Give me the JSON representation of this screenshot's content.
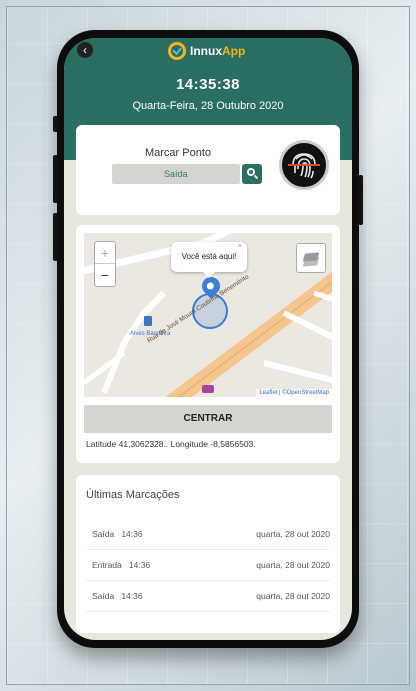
{
  "app": {
    "name_part1": "Innux",
    "name_part2": "App",
    "back_icon": "back-arrow-icon",
    "accent_color": "#2a6d62",
    "logo_ring_color": "#f2b51c"
  },
  "header": {
    "time": "14:35:38",
    "date": "Quarta-Feira, 28 Outubro 2020"
  },
  "punch": {
    "title": "Marcar Ponto",
    "selected_type": "Saída",
    "search_icon": "search-icon",
    "fingerprint_icon": "fingerprint-icon"
  },
  "map": {
    "popup_text": "Você está aqui!",
    "popup_close": "×",
    "zoom_in": "+",
    "zoom_out": "−",
    "layers_icon": "layers-icon",
    "poi_label": "Alves Bandeira",
    "road_label": "Rua de José Moura Coutinho Benemérito",
    "attribution": "Leaflet | ©OpenStreetMap",
    "center_label": "CENTRAR",
    "coordinates": "Latitude 41,3062328.. Longitude -8,5856503."
  },
  "history": {
    "title": "Últimas Marcações",
    "rows": [
      {
        "type": "Saída",
        "time": "14:36",
        "date": "quarta, 28 out 2020"
      },
      {
        "type": "Entrada",
        "time": "14:36",
        "date": "quarta, 28 out 2020"
      },
      {
        "type": "Saída",
        "time": "14:36",
        "date": "quarta, 28 out 2020"
      }
    ]
  }
}
